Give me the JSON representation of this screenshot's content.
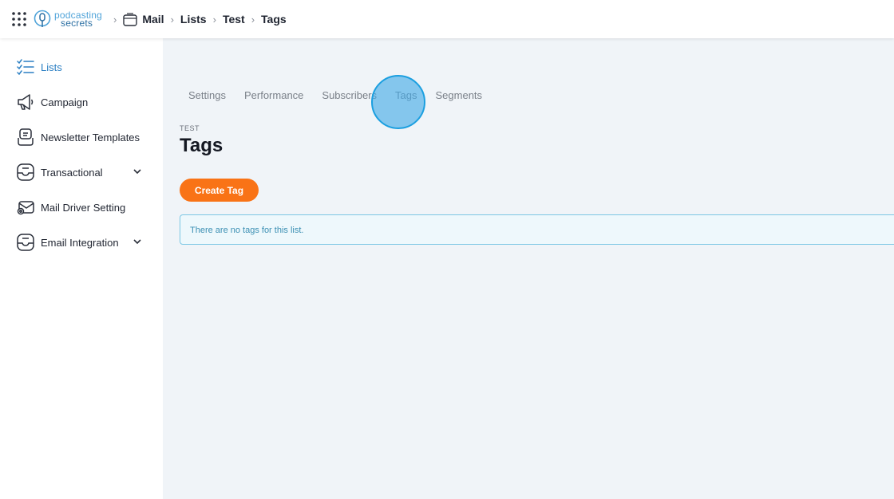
{
  "topbar": {
    "brand_line1": "podcasting",
    "brand_line2": "secrets",
    "breadcrumbs": [
      "Mail",
      "Lists",
      "Test",
      "Tags"
    ]
  },
  "sidebar": {
    "items": [
      {
        "label": "Lists",
        "icon": "checklist-icon",
        "active": true
      },
      {
        "label": "Campaign",
        "icon": "megaphone-icon"
      },
      {
        "label": "Newsletter Templates",
        "icon": "template-icon"
      },
      {
        "label": "Transactional",
        "icon": "inbox-icon",
        "expandable": true
      },
      {
        "label": "Mail Driver Setting",
        "icon": "mail-settings-icon"
      },
      {
        "label": "Email Integration",
        "icon": "inbox-icon",
        "expandable": true
      }
    ]
  },
  "main": {
    "tabs": [
      {
        "label": "Settings"
      },
      {
        "label": "Performance"
      },
      {
        "label": "Subscribers"
      },
      {
        "label": "Tags",
        "active": true
      },
      {
        "label": "Segments"
      }
    ],
    "overline": "TEST",
    "title": "Tags",
    "create_button": "Create Tag",
    "empty_notice": "There are no tags for this list."
  },
  "colors": {
    "accent": "#f97316",
    "active_nav": "#2b7fc3",
    "notice_border": "#7cc7e4",
    "notice_bg": "#eef8fc",
    "main_bg": "#f0f4f8"
  }
}
